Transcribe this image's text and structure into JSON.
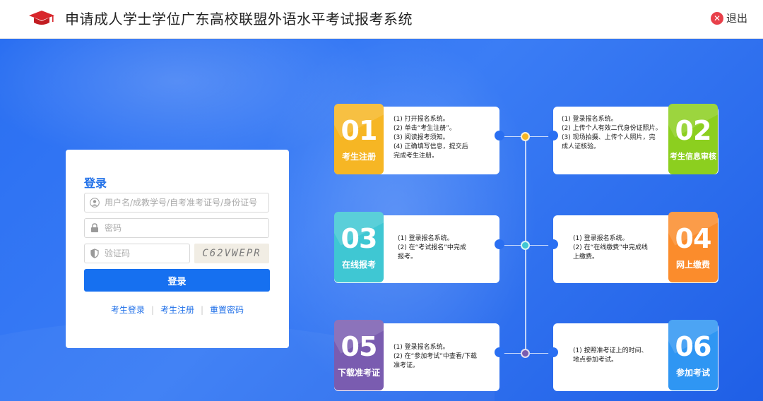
{
  "header": {
    "title": "申请成人学士学位广东高校联盟外语水平考试报考系统",
    "logout_label": "退出"
  },
  "login": {
    "title": "登录",
    "username_placeholder": "用户名/成教学号/自考准考证号/身份证号",
    "password_placeholder": "密码",
    "code_placeholder": "验证码",
    "captcha_text": "C62VWEPR",
    "submit_label": "登录",
    "links": [
      "考生登录",
      "考生注册",
      "重置密码"
    ]
  },
  "steps": [
    {
      "num": "01",
      "label": "考生注册",
      "color": "#f6b624",
      "desc": "(1) 打开报名系统。\n(2) 单击“考生注册”。\n(3) 阅读报考须知。\n(4) 正确填写信息，提交后\n      完成考生注册。"
    },
    {
      "num": "02",
      "label": "考生信息审核",
      "color": "#8ccf1f",
      "desc": "(1) 登录报名系统。\n(2) 上传个人有效二代身份证照片。\n(3) 现场拍摄、上传个人照片，完\n      成人证核验。"
    },
    {
      "num": "03",
      "label": "在线报考",
      "color": "#3fc7d3",
      "desc": "(1) 登录报名系统。\n(2) 在“考试报名”中完成\n      报考。"
    },
    {
      "num": "04",
      "label": "网上缴费",
      "color": "#fb8c2c",
      "desc": "(1) 登录报名系统。\n(2) 在“在线缴费”中完成线\n      上缴费。"
    },
    {
      "num": "05",
      "label": "下载准考证",
      "color": "#7a5cb0",
      "desc": "(1) 登录报名系统。\n(2) 在“参加考试”中查看/下载\n      准考证。"
    },
    {
      "num": "06",
      "label": "参加考试",
      "color": "#2f96f3",
      "desc": "(1) 按照准考证上的时间、\n      地点参加考试。"
    }
  ],
  "colors": {
    "banner": "#2a6ff2",
    "primary": "#1670f0",
    "logout": "#e8404a",
    "dot_top": "#f6b624",
    "dot_mid": "#3fc7d3",
    "dot_bottom": "#7a5cb0"
  }
}
